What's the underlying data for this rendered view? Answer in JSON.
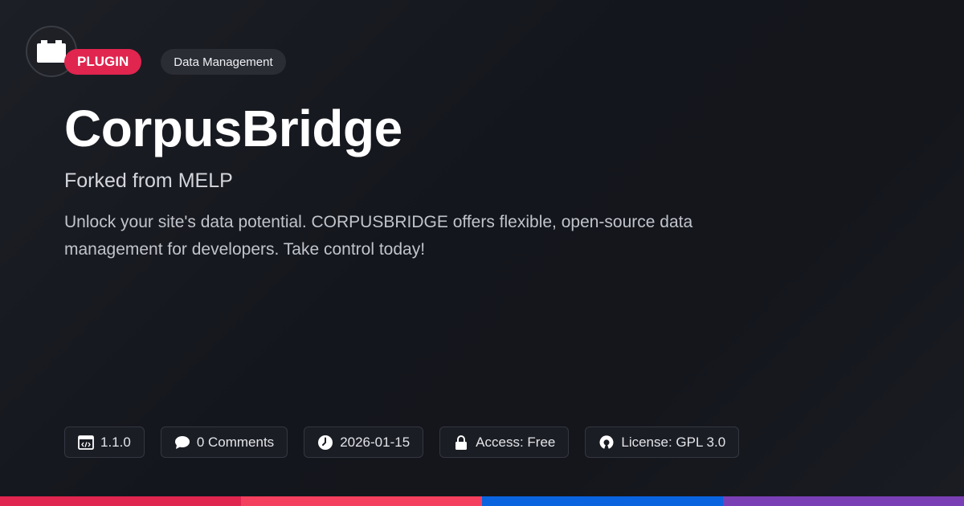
{
  "badges": {
    "type": "PLUGIN",
    "category": "Data Management"
  },
  "title": "CorpusBridge",
  "subtitle": "Forked from MELP",
  "description": "Unlock your site's data potential. CORPUSBRIDGE offers flexible, open-source data management for developers. Take control today!",
  "meta": {
    "version": "1.1.0",
    "comments": "0 Comments",
    "date": "2026-01-15",
    "access": "Access: Free",
    "license": "License: GPL 3.0"
  },
  "icons": {
    "logo": "plugin-block-icon",
    "version": "code-window-icon",
    "comments": "speech-bubble-icon",
    "date": "clock-icon",
    "access": "lock-icon",
    "license": "open-source-icon"
  },
  "colors": {
    "accent": "#e0254f",
    "bottom_bar": [
      "#e0254f",
      "#f43f5e",
      "#0a64e0",
      "#7b3fb5"
    ]
  }
}
